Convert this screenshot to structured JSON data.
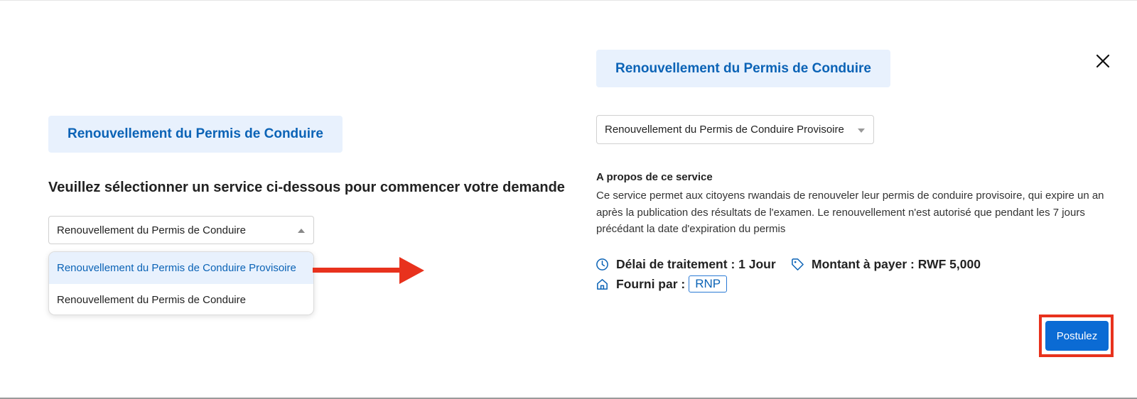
{
  "left_panel": {
    "title": "Renouvellement du Permis de Conduire",
    "prompt": "Veuillez sélectionner un service ci-dessous pour commencer votre demande",
    "select_value": "Renouvellement du Permis de Conduire",
    "dropdown_options": [
      "Renouvellement du Permis de Conduire Provisoire",
      "Renouvellement du Permis de Conduire"
    ]
  },
  "right_panel": {
    "title": "Renouvellement du Permis de Conduire",
    "select_value": "Renouvellement du Permis de Conduire Provisoire",
    "about_title": "A propos de ce service",
    "about_text": "Ce service permet aux citoyens rwandais de renouveler leur permis de conduire provisoire, qui expire un an après la publication des résultats de l'examen. Le renouvellement n'est autorisé que pendant les 7 jours précédant la date d'expiration du permis",
    "delai_label": "Délai de traitement : 1 Jour",
    "montant_label": "Montant à payer : RWF 5,000",
    "fourni_label": "Fourni par :",
    "provider": "RNP",
    "apply_button": "Postulez"
  },
  "icons": {
    "close": "close-icon",
    "clock": "clock-icon",
    "tag": "tag-icon",
    "home": "home-icon"
  },
  "colors": {
    "accent": "#0b63b6",
    "chip_bg": "#e8f1fd",
    "button": "#0b6bd4",
    "annotation": "#e8321d"
  }
}
